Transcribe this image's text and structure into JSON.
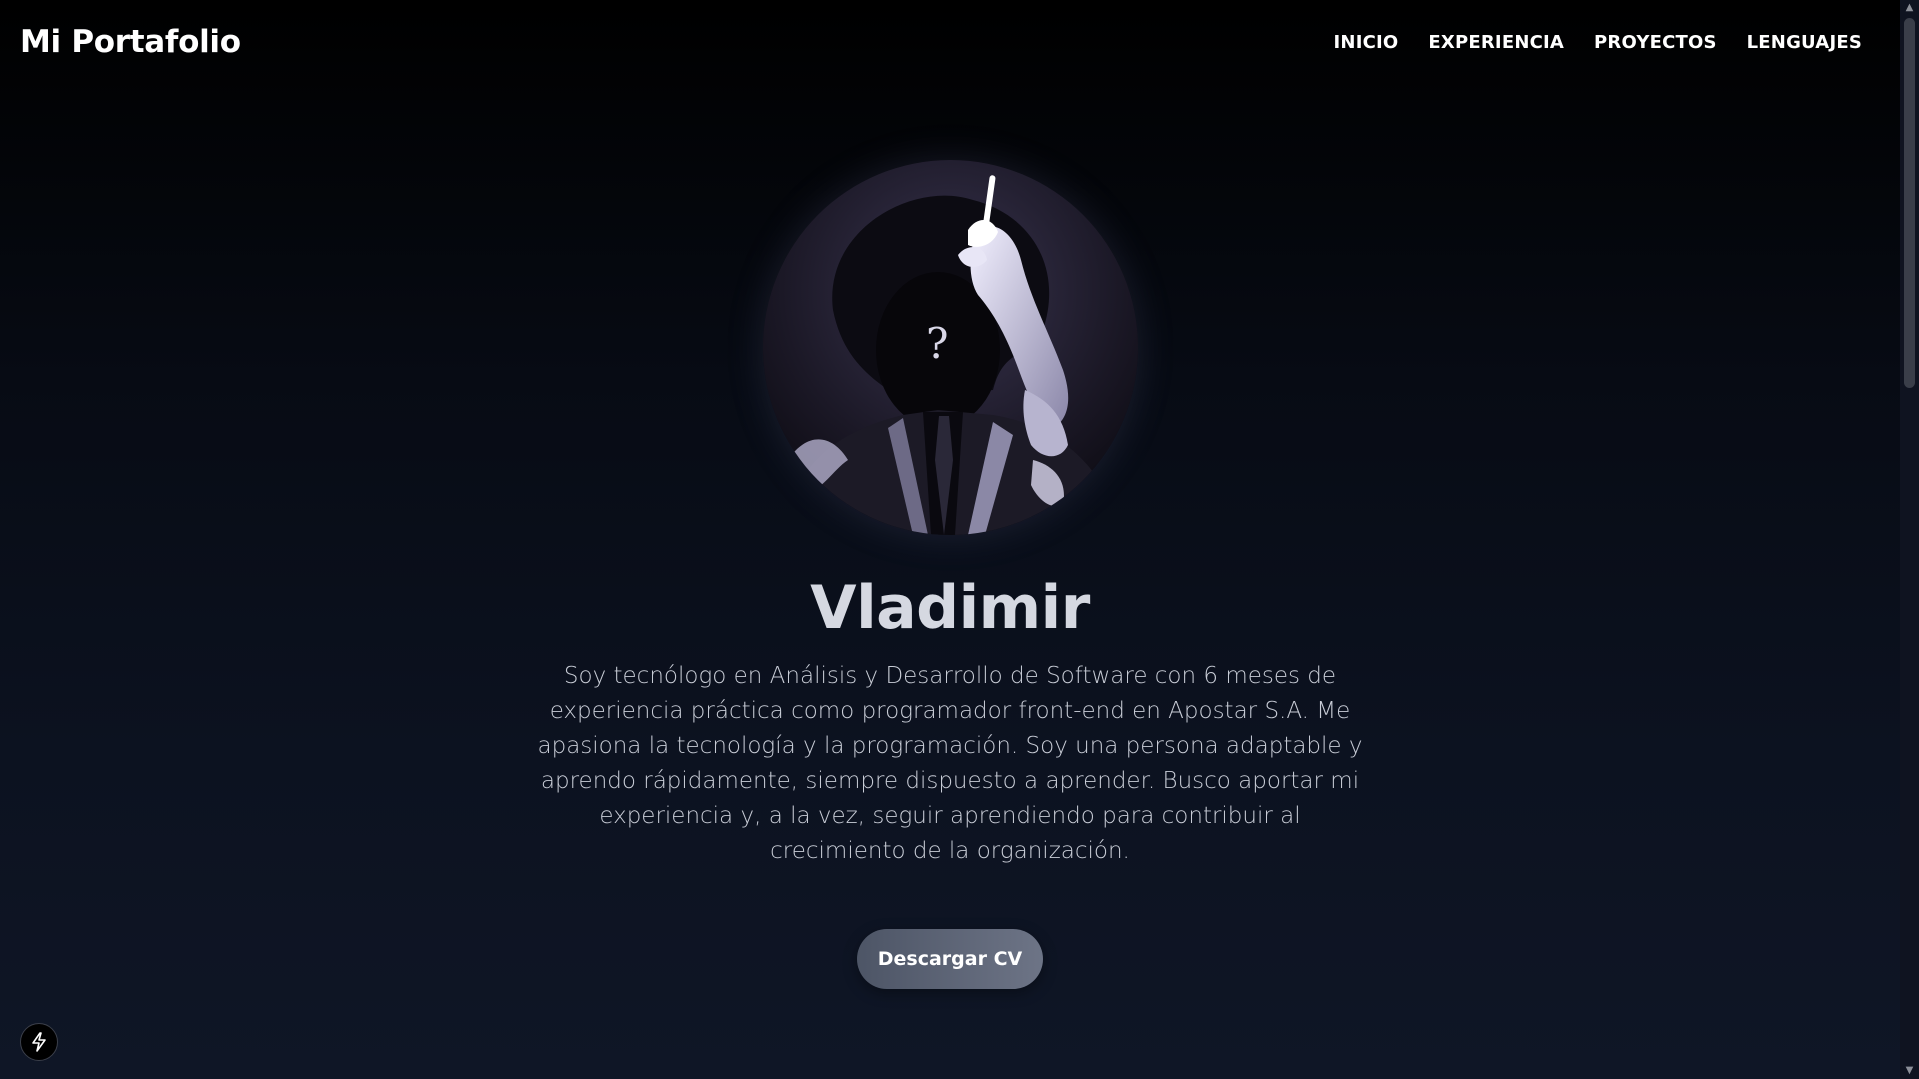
{
  "header": {
    "brand": "Mi Portafolio",
    "nav": [
      {
        "label": "INICIO"
      },
      {
        "label": "EXPERIENCIA"
      },
      {
        "label": "PROYECTOS"
      },
      {
        "label": "LENGUAJES"
      }
    ]
  },
  "hero": {
    "avatar_mark": "?",
    "name": "Vladimir",
    "bio": "Soy tecnólogo en Análisis y Desarrollo de Software con 6 meses de experiencia práctica como programador front-end en Apostar S.A. Me apasiona la tecnología y la programación. Soy una persona adaptable y aprendo rápidamente, siempre dispuesto a aprender. Busco aportar mi experiencia y, a la vez, seguir aprendiendo para contribuir al crecimiento de la organización.",
    "cta_label": "Descargar CV"
  },
  "icons": {
    "dev_badge": "lightning-bolt-icon",
    "scroll_up": "chevron-up-icon",
    "scroll_down": "chevron-down-icon"
  },
  "colors": {
    "background_top": "#000000",
    "background_bottom": "#0f1626",
    "button_start": "#4d5566",
    "button_end": "#6d7486"
  }
}
